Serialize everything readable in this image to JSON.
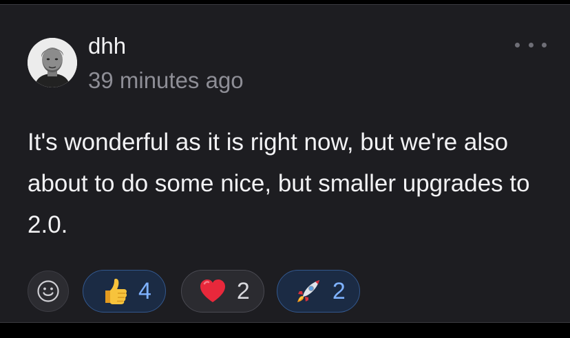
{
  "comment": {
    "author": "dhh",
    "timestamp": "39 minutes ago",
    "text": "It's wonderful as it is right now, but we're also about to do some nice, but smaller upgrades to 2.0.",
    "more_icon": "ellipsis-icon",
    "avatar_icon": "avatar"
  },
  "reactions": {
    "add_icon": "smiley-icon",
    "items": [
      {
        "emoji": "thumbs-up-icon",
        "count": "4",
        "reacted": true
      },
      {
        "emoji": "heart-icon",
        "count": "2",
        "reacted": false
      },
      {
        "emoji": "rocket-icon",
        "count": "2",
        "reacted": true
      }
    ]
  },
  "colors": {
    "background": "#1d1d21",
    "text": "#f2f2f4",
    "muted": "#8e8e96",
    "active_pill_bg": "#1b2b44",
    "active_pill_border": "#33588e",
    "active_count": "#7fb2ff",
    "inactive_pill_bg": "#2b2b30"
  }
}
